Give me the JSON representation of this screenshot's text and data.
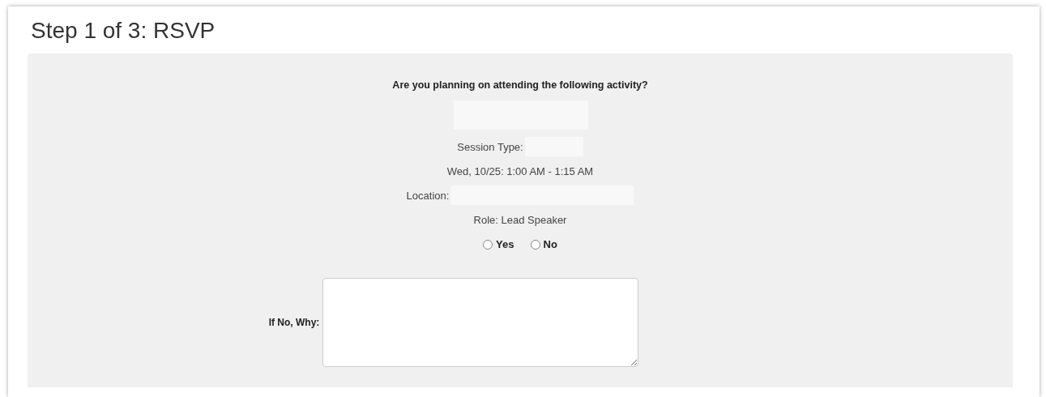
{
  "title": "Step 1 of 3: RSVP",
  "question": "Are you planning on attending the following activity?",
  "details": [
    {
      "kind": "blank"
    },
    {
      "kind": "label",
      "text": "Session Type:"
    },
    {
      "kind": "text",
      "text": "Wed, 10/25: 1:00 AM - 1:15 AM"
    },
    {
      "kind": "label",
      "text": "Location:"
    },
    {
      "kind": "text",
      "text": "Role: Lead Speaker"
    }
  ],
  "options": [
    {
      "label": "Yes",
      "selected": false
    },
    {
      "label": "No",
      "selected": false
    }
  ],
  "reason": {
    "label": "If No, Why:"
  }
}
